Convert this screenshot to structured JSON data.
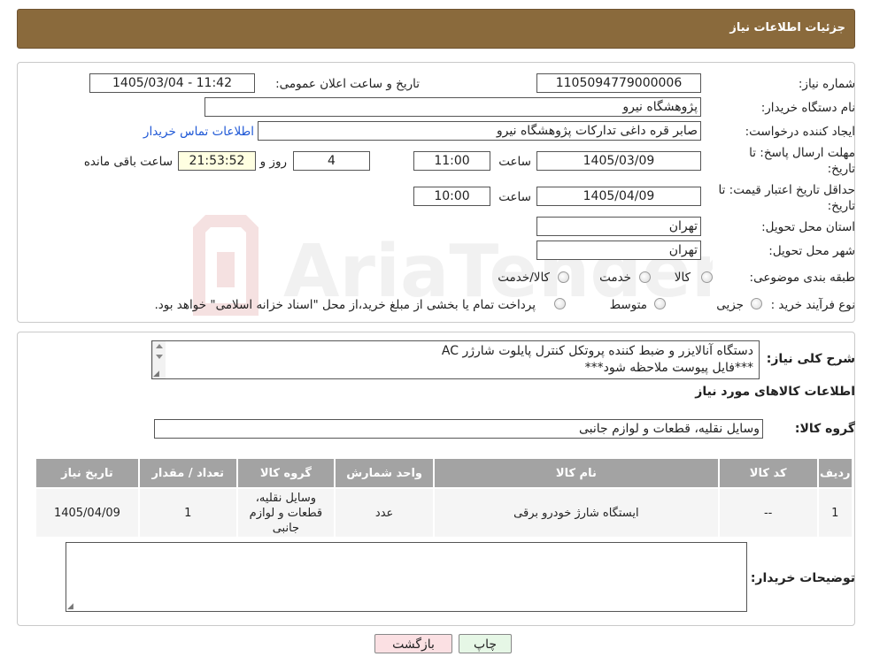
{
  "header": {
    "title": "جزئیات اطلاعات نیاز"
  },
  "form": {
    "need_number_label": "شماره نیاز:",
    "need_number": "1105094779000006",
    "announce_label": "تاریخ و ساعت اعلان عمومی:",
    "announce_value": "1405/03/04 - 11:42",
    "buyer_org_label": "نام دستگاه خریدار:",
    "buyer_org": "پژوهشگاه نیرو",
    "creator_label": "ایجاد کننده درخواست:",
    "creator": "صابر قره داغی تدارکات پژوهشگاه نیرو",
    "contact_link": "اطلاعات تماس خریدار",
    "deadline_label_1": "مهلت ارسال پاسخ: تا",
    "deadline_label_2": "تاریخ:",
    "deadline_date": "1405/03/09",
    "hour_label": "ساعت",
    "deadline_time": "11:00",
    "days_value": "4",
    "days_label": "روز و",
    "remaining_time": "21:53:52",
    "remaining_label": "ساعت باقی مانده",
    "validity_label_1": "حداقل تاریخ اعتبار قیمت: تا",
    "validity_label_2": "تاریخ:",
    "validity_date": "1405/04/09",
    "validity_hour_label": "ساعت",
    "validity_time": "10:00",
    "province_label": "استان محل تحویل:",
    "province": "تهران",
    "city_label": "شهر محل تحویل:",
    "city": "تهران",
    "category_label": "طبقه بندی موضوعی:",
    "category_options": [
      "کالا",
      "خدمت",
      "کالا/خدمت"
    ],
    "process_label": "نوع فرآیند خرید :",
    "process_options": [
      "جزیی",
      "متوسط"
    ],
    "payment_note": "پرداخت تمام یا بخشی از مبلغ خرید،از محل \"اسناد خزانه اسلامی\" خواهد بود."
  },
  "details": {
    "summary_label": "شرح کلی نیاز:",
    "summary_line1": "دستگاه آنالایزر و ضبط کننده پروتکل کنترل پایلوت شارژر AC",
    "summary_line2": "***فایل پیوست ملاحظه شود***",
    "goods_info_title": "اطلاعات کالاهای مورد نیاز",
    "goods_group_label": "گروه کالا:",
    "goods_group": "وسایل نقلیه، قطعات و لوازم جانبی"
  },
  "table": {
    "headers": [
      "ردیف",
      "کد کالا",
      "نام کالا",
      "واحد شمارش",
      "گروه کالا",
      "تعداد / مقدار",
      "تاریخ نیاز"
    ],
    "rows": [
      [
        "1",
        "--",
        "ایستگاه شارژ خودرو برقی",
        "عدد",
        "وسایل نقلیه، قطعات و لوازم جانبی",
        "1",
        "1405/04/09"
      ]
    ]
  },
  "buyer_notes_label": "توضیحات خریدار:",
  "buttons": {
    "print": "چاپ",
    "back": "بازگشت"
  },
  "watermark_text": "AriaTender.neT"
}
